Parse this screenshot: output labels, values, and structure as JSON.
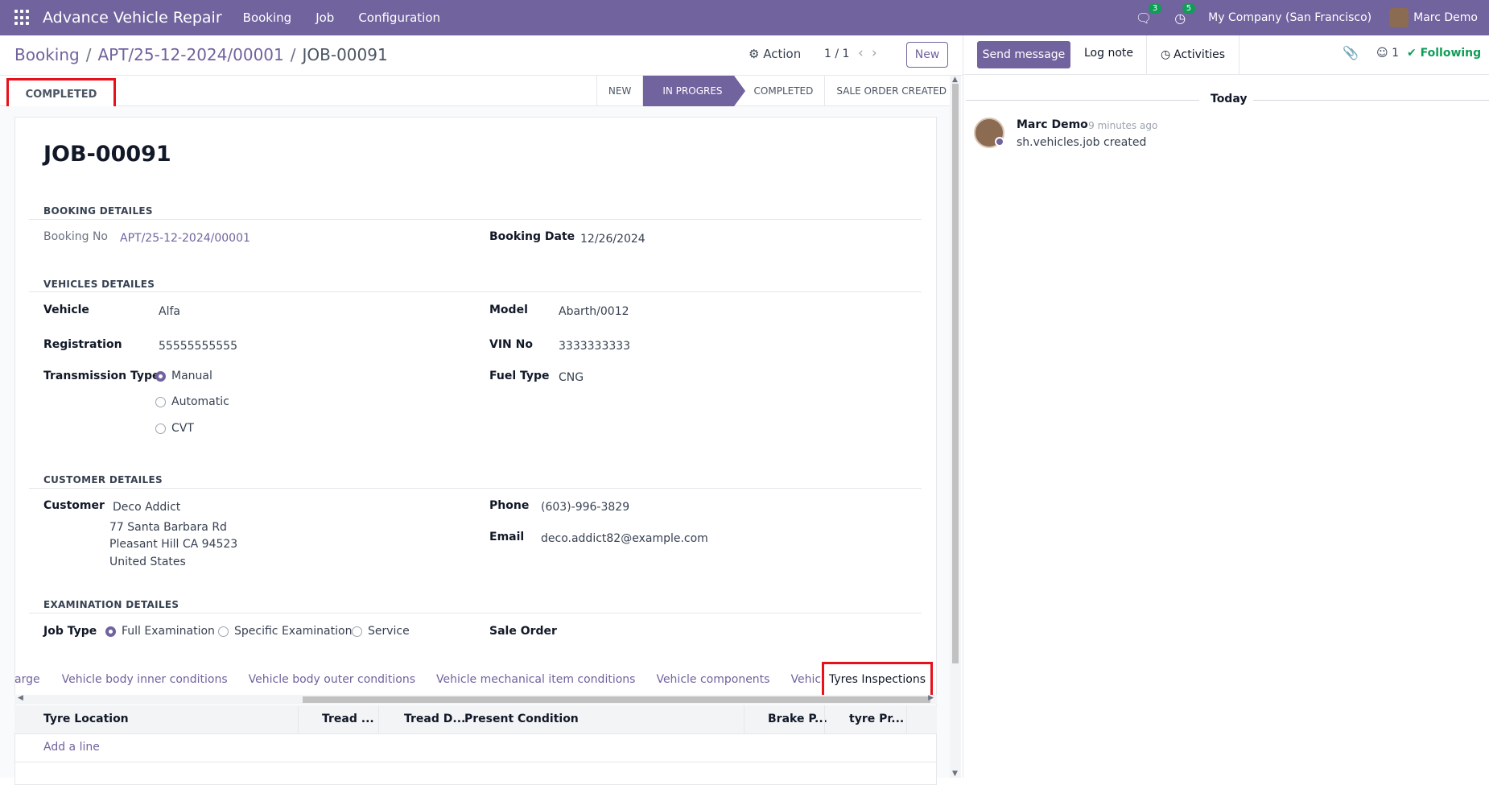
{
  "navbar": {
    "brand": "Advance Vehicle Repair",
    "menu": [
      "Booking",
      "Job",
      "Configuration"
    ],
    "messages_count": "3",
    "activities_count": "5",
    "company": "My Company (San Francisco)",
    "user": "Marc Demo"
  },
  "control_panel": {
    "breadcrumb": [
      "Booking",
      "APT/25-12-2024/00001",
      "JOB-00091"
    ],
    "action_label": "Action",
    "pager": "1 / 1",
    "new_label": "New"
  },
  "statusbar": {
    "button_label": "COMPLETED",
    "stages": [
      "NEW",
      "IN PROGRES",
      "COMPLETED",
      "SALE ORDER CREATED"
    ],
    "active_stage": "IN PROGRES"
  },
  "form": {
    "title": "JOB-00091",
    "booking_section": "BOOKING DETAILES",
    "booking_no_label": "Booking No",
    "booking_no": "APT/25-12-2024/00001",
    "booking_date_label": "Booking Date",
    "booking_date": "12/26/2024",
    "vehicles_section": "VEHICLES DETAILES",
    "vehicle_label": "Vehicle",
    "vehicle": "Alfa",
    "model_label": "Model",
    "model": "Abarth/0012",
    "registration_label": "Registration",
    "registration": "55555555555",
    "vin_label": "VIN No",
    "vin": "3333333333",
    "transmission_label": "Transmission Type",
    "transmission_options": [
      "Manual",
      "Automatic",
      "CVT"
    ],
    "transmission_selected": "Manual",
    "fuel_label": "Fuel Type",
    "fuel": "CNG",
    "customer_section": "CUSTOMER DETAILES",
    "customer_label": "Customer",
    "customer_name": "Deco Addict",
    "customer_address": [
      "77 Santa Barbara Rd",
      "Pleasant Hill CA 94523",
      "United States"
    ],
    "phone_label": "Phone",
    "phone": "(603)-996-3829",
    "email_label": "Email",
    "email": "deco.addict82@example.com",
    "examination_section": "EXAMINATION DETAILES",
    "job_type_label": "Job Type",
    "job_type_options": [
      "Full Examination",
      "Specific Examination",
      "Service"
    ],
    "job_type_selected": "Full Examination",
    "sale_order_label": "Sale Order"
  },
  "notebook": {
    "tabs": [
      "arge",
      "Vehicle body inner conditions",
      "Vehicle body outer conditions",
      "Vehicle mechanical item conditions",
      "Vehicle components",
      "Vehicle fluids",
      "Tyres Inspections"
    ],
    "active_tab": "Tyres Inspections",
    "columns": [
      "Tyre Location",
      "Tread ...",
      "Tread D...",
      "Present Condition",
      "Brake P...",
      "tyre Pr..."
    ],
    "add_line": "Add a line"
  },
  "chatter": {
    "send_message": "Send message",
    "log_note": "Log note",
    "activities": "Activities",
    "followers_count": "1",
    "following": "Following",
    "date_separator": "Today",
    "messages": [
      {
        "author": "Marc Demo",
        "time": "- 9 minutes ago",
        "body": "sh.vehicles.job created"
      }
    ]
  }
}
